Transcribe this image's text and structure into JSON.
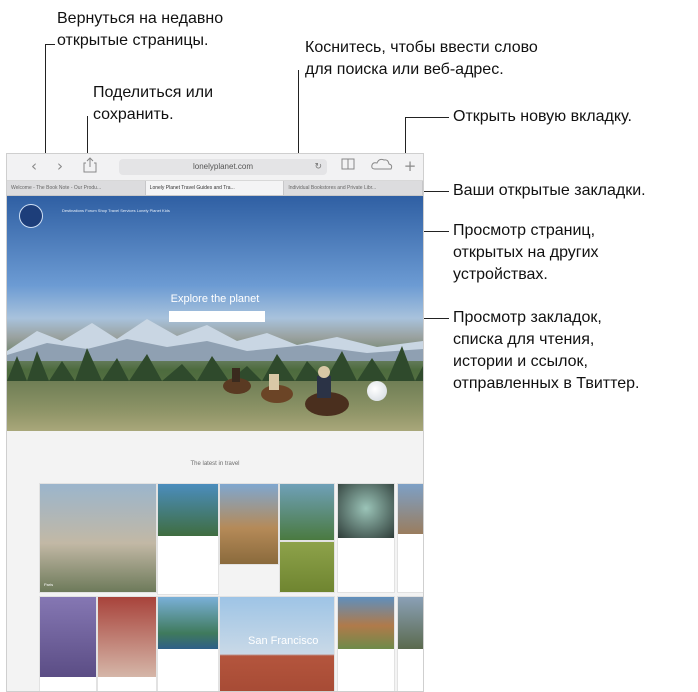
{
  "callouts": {
    "recent_pages": "Вернуться на недавно\nоткрытые страницы.",
    "share_save": "Поделиться или\nсохранить.",
    "search_or_address": "Коснитесь, чтобы ввести слово\nдля поиска или веб-адрес.",
    "new_tab": "Открыть новую вкладку.",
    "open_tabs": "Ваши открытые закладки.",
    "other_devices": "Просмотр страниц,\nоткрытых на других\nустройствах.",
    "bookmarks": "Просмотр закладок,\nсписка для чтения,\nистории и ссылок,\nотправленных в Твиттер."
  },
  "browser": {
    "url": "lonelyplanet.com",
    "tabs": [
      {
        "label": "Welcome - The Book Note - Our Produ...",
        "active": false
      },
      {
        "label": "Lonely Planet Travel Guides and Tra...",
        "active": true
      },
      {
        "label": "Individual Bookstores and Private Libr...",
        "active": false
      }
    ],
    "icons": {
      "back": "chevron-left-icon",
      "forward": "chevron-right-icon",
      "share": "share-icon",
      "reload": "reload-icon",
      "bookmarks": "bookmarks-icon",
      "cloud_tabs": "cloud-icon",
      "new_tab": "plus-icon"
    }
  },
  "page": {
    "nav_links": "Destinations  Forum  Shop  Travel Services  Lonely Planet Kids",
    "hero_title": "Explore the planet",
    "lower_title": "The latest in travel",
    "card_captions": [
      "Paris",
      "",
      "",
      "",
      "",
      "",
      "San Francisco"
    ]
  }
}
